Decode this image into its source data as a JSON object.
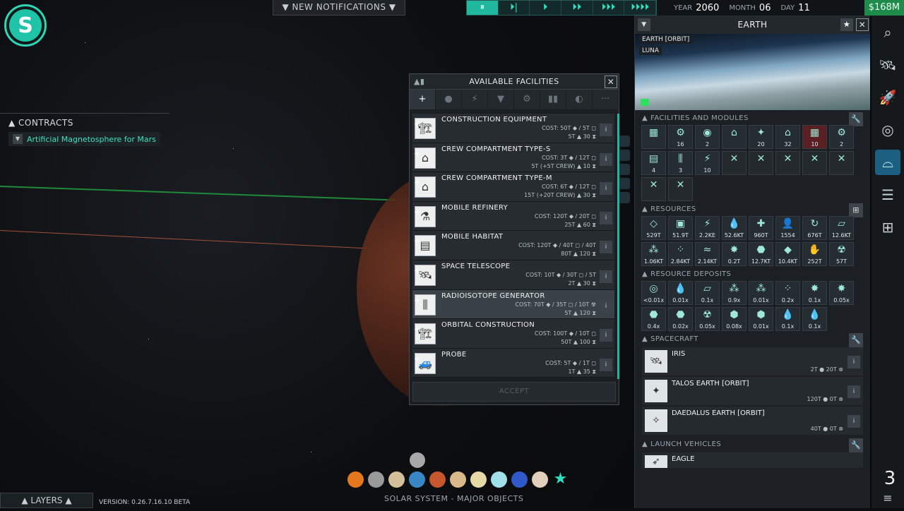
{
  "top": {
    "notifications": "▼ NEW NOTIFICATIONS ▼",
    "speed": [
      "⏸",
      "⏵|",
      "⏵",
      "⏵⏵",
      "⏵⏵⏵",
      "⏵⏵⏵⏵"
    ],
    "year_label": "YEAR",
    "year": "2060",
    "month_label": "MONTH",
    "month": "06",
    "day_label": "DAY",
    "day": "11",
    "money": "$168M"
  },
  "contracts": {
    "header": "CONTRACTS",
    "item": "Artificial Magnetosphere for Mars"
  },
  "facilities": {
    "title": "AVAILABLE FACILITIES",
    "tabs": [
      "+",
      "●",
      "⚡",
      "▼",
      "⚙",
      "▮▮",
      "◐",
      "···"
    ],
    "accept": "ACCEPT",
    "rows": [
      {
        "name": "CONSTRUCTION EQUIPMENT",
        "cost": "COST: 50T ◆ / 5T ◻",
        "sub": "5T ▲   30 ⧗",
        "icon": "🏗"
      },
      {
        "name": "CREW COMPARTMENT TYPE-S",
        "cost": "COST: 3T ◆ / 12T ◻",
        "sub": "5T (+5T CREW) ▲   10 ⧗",
        "icon": "⌂"
      },
      {
        "name": "CREW COMPARTMENT TYPE-M",
        "cost": "COST: 6T ◆ / 12T ◻",
        "sub": "15T (+20T CREW) ▲   30 ⧗",
        "icon": "⌂"
      },
      {
        "name": "MOBILE REFINERY",
        "cost": "COST: 120T ◆ / 20T ◻",
        "sub": "25T ▲   60 ⧗",
        "icon": "⚗"
      },
      {
        "name": "MOBILE HABITAT",
        "cost": "COST: 120T ◆ / 40T ◻ / 40T",
        "sub": "80T ▲   120 ⧗",
        "icon": "▤"
      },
      {
        "name": "SPACE TELESCOPE",
        "cost": "COST: 10T ◆ / 30T ◻ / 5T",
        "sub": "2T ▲   30 ⧗",
        "icon": "🛰"
      },
      {
        "name": "RADIOISOTOPE GENERATOR",
        "cost": "COST: 70T ◆ / 35T ◻ / 10T ☢",
        "sub": "5T ▲   120 ⧗",
        "icon": "⫼"
      },
      {
        "name": "ORBITAL CONSTRUCTION",
        "cost": "COST: 100T ◆ / 10T ◻",
        "sub": "50T ▲   100 ⧗",
        "icon": "🏗"
      },
      {
        "name": "PROBE",
        "cost": "COST: 5T ◆ / 1T ◻",
        "sub": "1T ▲   35 ⧗",
        "icon": "🚙"
      }
    ]
  },
  "panel": {
    "title": "EARTH",
    "tags": [
      "EARTH [ORBIT]",
      "LUNA"
    ],
    "fac_header": "FACILITIES AND MODULES",
    "res_header": "RESOURCES",
    "dep_header": "RESOURCE DEPOSITS",
    "sc_header": "SPACECRAFT",
    "lv_header": "LAUNCH VEHICLES",
    "facilities": [
      {
        "g": "▦",
        "v": ""
      },
      {
        "g": "⚙",
        "v": "16"
      },
      {
        "g": "◉",
        "v": "2"
      },
      {
        "g": "⌂",
        "v": ""
      },
      {
        "g": "✦",
        "v": "20"
      },
      {
        "g": "⌂",
        "v": "32"
      },
      {
        "g": "▦",
        "v": "10"
      },
      {
        "g": "⚙",
        "v": "2"
      },
      {
        "g": "▤",
        "v": "4"
      },
      {
        "g": "⫼",
        "v": "3"
      },
      {
        "g": "⚡",
        "v": "10"
      },
      {
        "g": "",
        "v": ""
      },
      {
        "g": "",
        "v": ""
      },
      {
        "g": "",
        "v": ""
      },
      {
        "g": "",
        "v": ""
      },
      {
        "g": "",
        "v": ""
      },
      {
        "g": "",
        "v": ""
      },
      {
        "g": "",
        "v": ""
      }
    ],
    "resources": [
      {
        "g": "◇",
        "v": "529T"
      },
      {
        "g": "▣",
        "v": "51.9T"
      },
      {
        "g": "⚡",
        "v": "2.2KE"
      },
      {
        "g": "💧",
        "v": "52.6KT"
      },
      {
        "g": "✚",
        "v": "960T"
      },
      {
        "g": "👤",
        "v": "1554"
      },
      {
        "g": "↻",
        "v": "676T"
      },
      {
        "g": "▱",
        "v": "12.6KT"
      },
      {
        "g": "⁂",
        "v": "1.06KT"
      },
      {
        "g": "⁘",
        "v": "2.84KT"
      },
      {
        "g": "≈",
        "v": "2.14KT"
      },
      {
        "g": "✸",
        "v": "0.2T"
      },
      {
        "g": "⬣",
        "v": "12.7KT"
      },
      {
        "g": "◆",
        "v": "10.4KT"
      },
      {
        "g": "✋",
        "v": "252T"
      },
      {
        "g": "☢",
        "v": "57T"
      }
    ],
    "deposits": [
      {
        "g": "◎",
        "v": "<0.01x"
      },
      {
        "g": "💧",
        "v": "0.01x"
      },
      {
        "g": "▱",
        "v": "0.1x"
      },
      {
        "g": "⁂",
        "v": "0.9x"
      },
      {
        "g": "⁂",
        "v": "0.01x"
      },
      {
        "g": "⁘",
        "v": "0.2x"
      },
      {
        "g": "✸",
        "v": "0.1x"
      },
      {
        "g": "✸",
        "v": "0.05x"
      },
      {
        "g": "⬣",
        "v": "0.4x"
      },
      {
        "g": "⬣",
        "v": "0.02x"
      },
      {
        "g": "☢",
        "v": "0.05x"
      },
      {
        "g": "⬢",
        "v": "0.08x"
      },
      {
        "g": "⬢",
        "v": "0.01x"
      },
      {
        "g": "💧",
        "v": "0.1x"
      },
      {
        "g": "💧",
        "v": "0.1x"
      }
    ],
    "spacecraft": [
      {
        "n": "IRIS",
        "s": "2T ● 20T ⊗"
      },
      {
        "n": "TALOS EARTH [ORBIT]",
        "s": "120T ● 0T ⊗"
      },
      {
        "n": "DAEDALUS EARTH [ORBIT]",
        "s": "40T ● 0T ⊗"
      }
    ],
    "vehicle": "EAGLE"
  },
  "bottom": {
    "solar": "SOLAR SYSTEM - MAJOR OBJECTS",
    "layers": "▲ LAYERS ▲",
    "version": "VERSION: 0.26.7.16.10 BETA",
    "rail_num": "3"
  }
}
